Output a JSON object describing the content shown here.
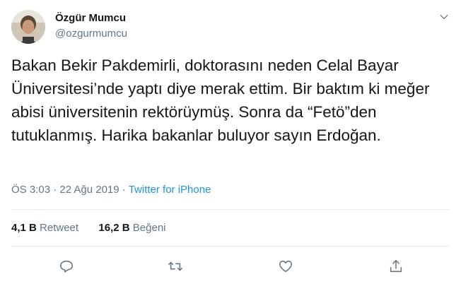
{
  "author": {
    "name": "Özgür Mumcu",
    "handle": "@ozgurmumcu"
  },
  "tweet": {
    "text": "Bakan Bekir Pakdemirli, doktorasını neden Celal Bayar Üniversitesi’nde yaptı diye merak ettim. Bir baktım ki meğer abisi üniversitenin rektörüymüş. Sonra da “Fetö”den tutuklanmış. Harika bakanlar buluyor sayın Erdoğan.",
    "timestamp": "ÖS 3:03 · 22 Ağu 2019",
    "separator": " · ",
    "source": "Twitter for iPhone"
  },
  "stats": {
    "retweets_value": "4,1 B",
    "retweets_label": "Retweet",
    "likes_value": "16,2 B",
    "likes_label": "Beğeni"
  },
  "icons": {
    "menu": "chevron-down-icon",
    "reply": "reply-icon",
    "retweet": "retweet-icon",
    "like": "heart-icon",
    "share": "share-icon"
  },
  "colors": {
    "text": "#14171a",
    "secondary": "#657786",
    "link": "#1b95e0",
    "divider": "#e6ecf0"
  }
}
